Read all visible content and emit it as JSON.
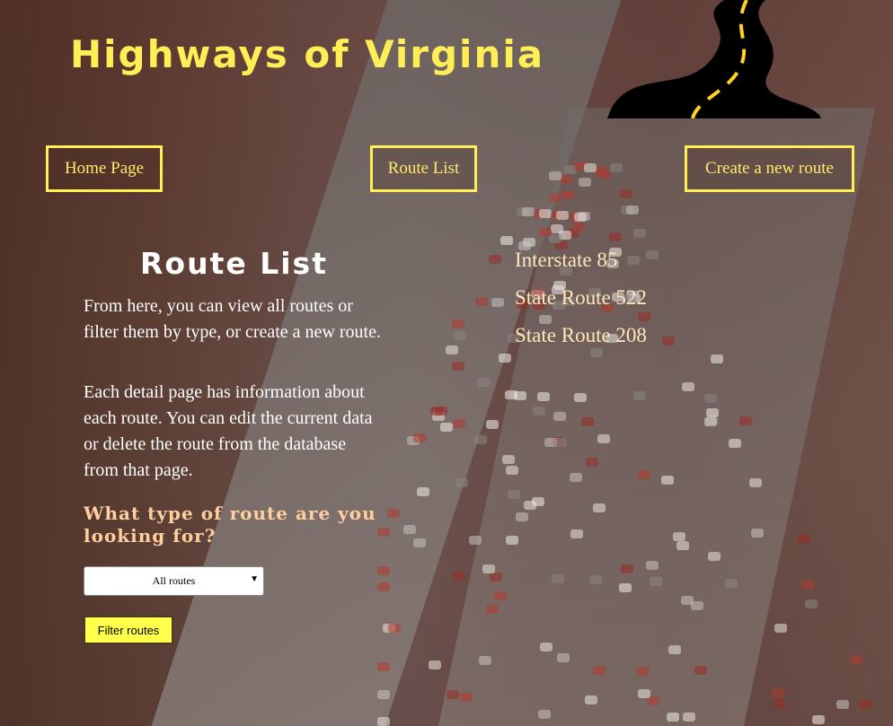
{
  "site": {
    "title": "Highways of Virginia"
  },
  "logo": {
    "icon": "winding-road-icon",
    "road_color": "#000000",
    "stripe_color": "#ffd21f"
  },
  "nav": {
    "home_label": "Home Page",
    "route_list_label": "Route List",
    "create_label": "Create a new route"
  },
  "panel": {
    "title": "Route List",
    "intro": "From here, you can view all routes or filter them by type, or create a new route.",
    "detail": "Each detail page has information about each route. You can edit the current data or delete the route from the database from that page.",
    "question": "What type of route are you looking for?",
    "select_value": "All routes",
    "filter_label": "Filter routes"
  },
  "routes": [
    "Interstate 85",
    "State Route 522",
    "State Route 208"
  ],
  "colors": {
    "accent": "#ffee55",
    "button": "#ffff4c",
    "route_text": "#ffe7b8",
    "question_text": "#ffcf9e"
  }
}
